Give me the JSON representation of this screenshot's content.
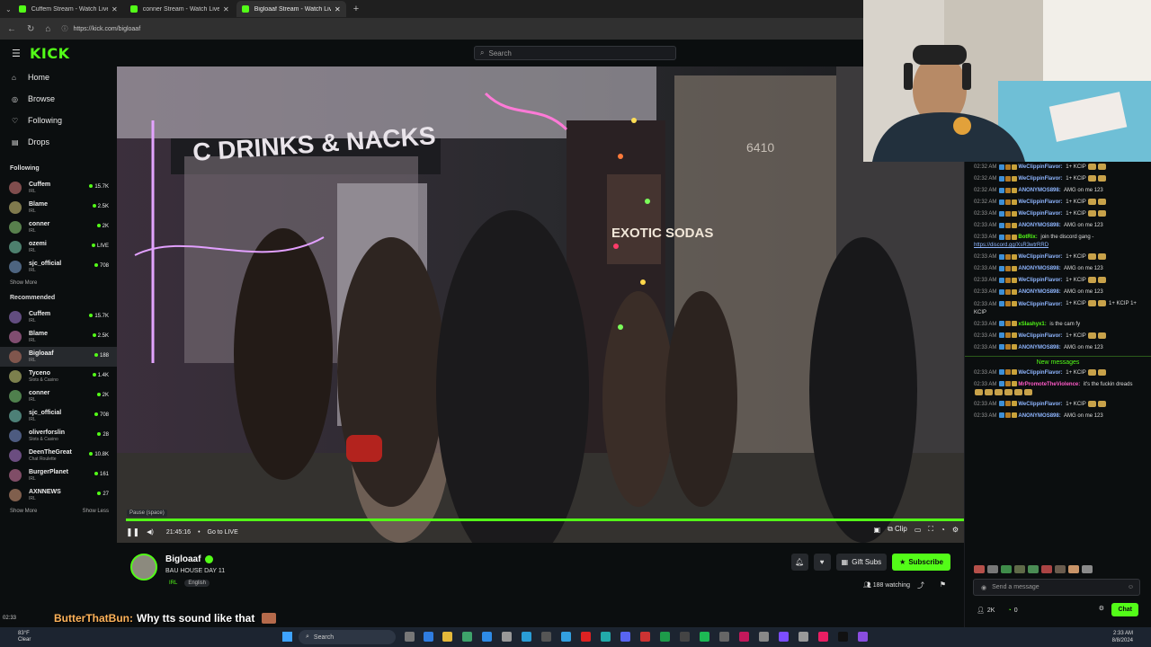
{
  "browser": {
    "tabs": [
      {
        "title": "Cuffem Stream - Watch Live o..."
      },
      {
        "title": "conner Stream - Watch Live on Ki..."
      },
      {
        "title": "Bigloaaf Stream - Watch Live ..."
      }
    ],
    "url": "https://kick.com/bigloaaf"
  },
  "header": {
    "logo": "KICK",
    "search_placeholder": "Search"
  },
  "sidebar": {
    "nav": [
      {
        "label": "Home",
        "icon": "home-icon"
      },
      {
        "label": "Browse",
        "icon": "compass-icon"
      },
      {
        "label": "Following",
        "icon": "heart-icon"
      },
      {
        "label": "Drops",
        "icon": "drops-icon"
      }
    ],
    "following_title": "Following",
    "following": [
      {
        "name": "Cuffem",
        "category": "IRL",
        "viewers": "15.7K"
      },
      {
        "name": "Blame",
        "category": "IRL",
        "viewers": "2.5K"
      },
      {
        "name": "conner",
        "category": "IRL",
        "viewers": "2K"
      },
      {
        "name": "ozemi",
        "category": "IRL",
        "viewers": "LIVE"
      },
      {
        "name": "sjc_official",
        "category": "IRL",
        "viewers": "708"
      }
    ],
    "show_more": "Show More",
    "recommended_title": "Recommended",
    "recommended": [
      {
        "name": "Cuffem",
        "category": "IRL",
        "viewers": "15.7K"
      },
      {
        "name": "Blame",
        "category": "IRL",
        "viewers": "2.5K"
      },
      {
        "name": "Bigloaaf",
        "category": "IRL",
        "viewers": "188"
      },
      {
        "name": "Tyceno",
        "category": "Slots & Casino",
        "viewers": "1.4K"
      },
      {
        "name": "conner",
        "category": "IRL",
        "viewers": "2K"
      },
      {
        "name": "sjc_official",
        "category": "IRL",
        "viewers": "708"
      },
      {
        "name": "oliverforslin",
        "category": "Slots & Casino",
        "viewers": "28"
      },
      {
        "name": "DeenTheGreat",
        "category": "Chat Roulette",
        "viewers": "10.8K"
      },
      {
        "name": "BurgerPlanet",
        "category": "IRL",
        "viewers": "161"
      },
      {
        "name": "AXNNEWS",
        "category": "IRL",
        "viewers": "27"
      }
    ],
    "show_more_2": "Show More",
    "show_less": "Show Less"
  },
  "video": {
    "sign_text": "C DRINKS & NACKS",
    "sign2": "EXOTIC SODAS",
    "address": "6410",
    "tooltip": "Pause (space)",
    "time": "21:45:16",
    "go_live": "Go to LIVE",
    "clip": "Clip",
    "progress": 1.0
  },
  "stream": {
    "streamer": "Bigloaaf",
    "title": "BAU HOUSE DAY 11",
    "category": "IRL",
    "language": "English",
    "gift_subs": "Gift Subs",
    "subscribe": "Subscribe",
    "watching": "188 watching"
  },
  "tts": {
    "time": "02:33",
    "user": "ButterThatBun:",
    "message": "Why tts sound like that"
  },
  "chat": {
    "messages": [
      {
        "time": "02:32 AM",
        "user": "WeClippinFlavor:",
        "color": "#8fb6ff",
        "text": "1+ KCIP",
        "emotes": 2
      },
      {
        "time": "02:32 AM",
        "user": "WeClippinFlavor:",
        "color": "#8fb6ff",
        "text": "1+ KCIP",
        "emotes": 2
      },
      {
        "time": "02:32 AM",
        "user": "ANONYMOS898:",
        "color": "#8fb6ff",
        "text": "AMG on me 123",
        "emotes": 0
      },
      {
        "time": "02:32 AM",
        "user": "WeClippinFlavor:",
        "color": "#8fb6ff",
        "text": "1+ KCIP",
        "emotes": 2
      },
      {
        "time": "02:33 AM",
        "user": "WeClippinFlavor:",
        "color": "#8fb6ff",
        "text": "1+ KCIP",
        "emotes": 2
      },
      {
        "time": "02:33 AM",
        "user": "ANONYMOS898:",
        "color": "#8fb6ff",
        "text": "AMG on me 123",
        "emotes": 0
      },
      {
        "time": "02:33 AM",
        "user": "BotRix:",
        "color": "#53fc18",
        "text": "join the discord gang -",
        "link": "https://discord.gg/XsR3wtrRRD",
        "emotes": 0
      },
      {
        "time": "02:33 AM",
        "user": "WeClippinFlavor:",
        "color": "#8fb6ff",
        "text": "1+ KCIP",
        "emotes": 2
      },
      {
        "time": "02:33 AM",
        "user": "ANONYMOS898:",
        "color": "#8fb6ff",
        "text": "AMG on me 123",
        "emotes": 0
      },
      {
        "time": "02:33 AM",
        "user": "WeClippinFlavor:",
        "color": "#8fb6ff",
        "text": "1+ KCIP",
        "emotes": 2
      },
      {
        "time": "02:33 AM",
        "user": "ANONYMOS898:",
        "color": "#8fb6ff",
        "text": "AMG on me 123",
        "emotes": 0
      },
      {
        "time": "02:33 AM",
        "user": "WeClippinFlavor:",
        "color": "#8fb6ff",
        "text": "1+ KCIP",
        "extra": "1+ KCIP 1+ KCIP",
        "emotes": 2
      },
      {
        "time": "02:33 AM",
        "user": "xSlashyx1:",
        "color": "#53fc18",
        "text": "is the cam fy",
        "emotes": 0
      },
      {
        "time": "02:33 AM",
        "user": "WeClippinFlavor:",
        "color": "#8fb6ff",
        "text": "1+ KCIP",
        "emotes": 2
      },
      {
        "time": "02:33 AM",
        "user": "ANONYMOS898:",
        "color": "#8fb6ff",
        "text": "AMG on me 123",
        "emotes": 0
      }
    ],
    "new_messages": "New messages",
    "messages_after": [
      {
        "time": "02:33 AM",
        "user": "WeClippinFlavor:",
        "color": "#8fb6ff",
        "text": "1+ KCIP",
        "emotes": 2
      },
      {
        "time": "02:33 AM",
        "user": "MrPromoteTheViolence:",
        "color": "#ff5ac8",
        "text": "it's the fuckin dreads",
        "emotes": 6
      },
      {
        "time": "02:33 AM",
        "user": "WeClippinFlavor:",
        "color": "#8fb6ff",
        "text": "1+ KCIP",
        "emotes": 2
      },
      {
        "time": "02:33 AM",
        "user": "ANONYMOS898:",
        "color": "#8fb6ff",
        "text": "AMG on me 123",
        "emotes": 0
      }
    ],
    "input_placeholder": "Send a message",
    "followers": "2K",
    "points": "0",
    "chat_button": "Chat"
  },
  "taskbar": {
    "weather_temp": "83°F",
    "weather_desc": "Clear",
    "search": "Search",
    "time": "2:33 AM",
    "date": "8/8/2024"
  }
}
